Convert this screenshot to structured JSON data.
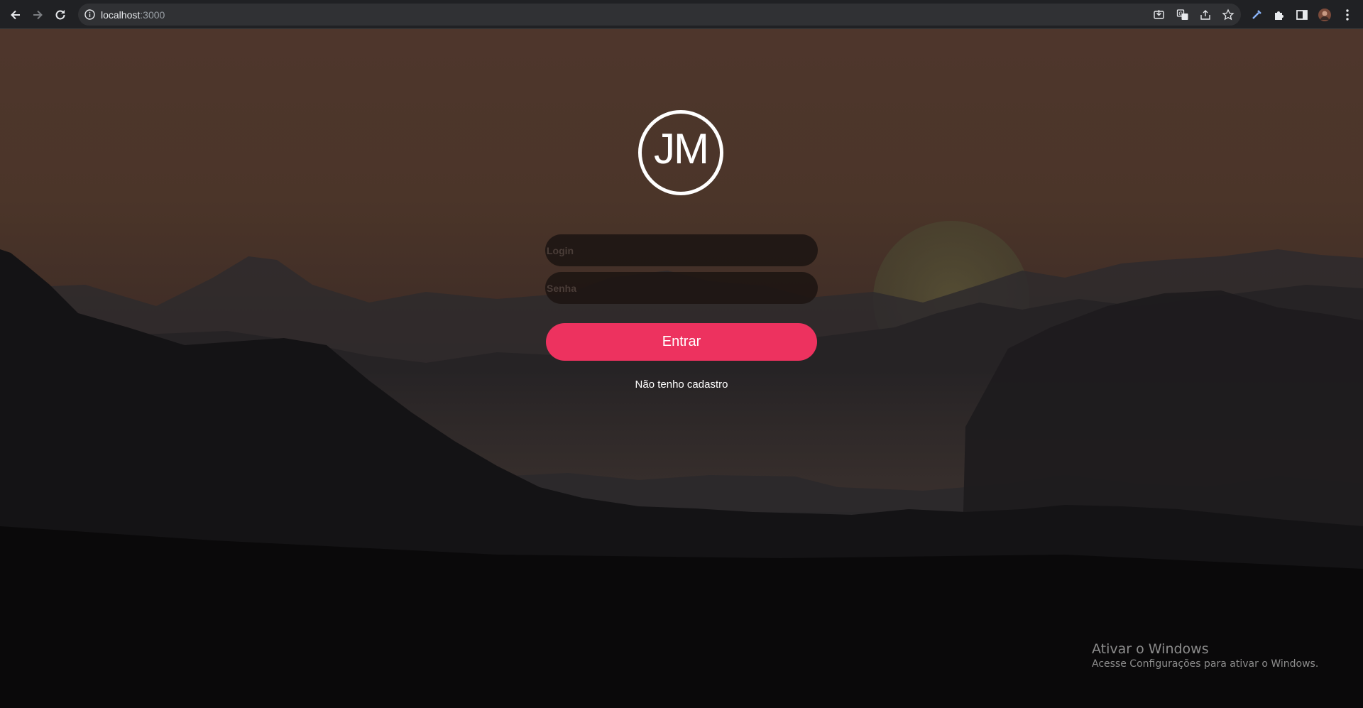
{
  "browser": {
    "url_host": "localhost",
    "url_port": ":3000",
    "icons": [
      "back-arrow-icon",
      "forward-arrow-icon",
      "reload-icon",
      "info-icon",
      "install-app-icon",
      "translate-icon",
      "share-icon",
      "bookmark-star-icon",
      "eyedropper-icon",
      "extensions-puzzle-icon",
      "side-panel-icon",
      "profile-avatar-icon",
      "kebab-menu-icon"
    ]
  },
  "login": {
    "logo_text": "JM",
    "login_placeholder": "Login",
    "password_placeholder": "Senha",
    "submit_label": "Entrar",
    "register_link": "Não tenho cadastro"
  },
  "colors": {
    "accent": "#ed325f",
    "field_bg": "#1c1412",
    "browser_bar": "#202124"
  },
  "windows_watermark": {
    "title": "Ativar o Windows",
    "subtitle": "Acesse Configurações para ativar o Windows."
  }
}
